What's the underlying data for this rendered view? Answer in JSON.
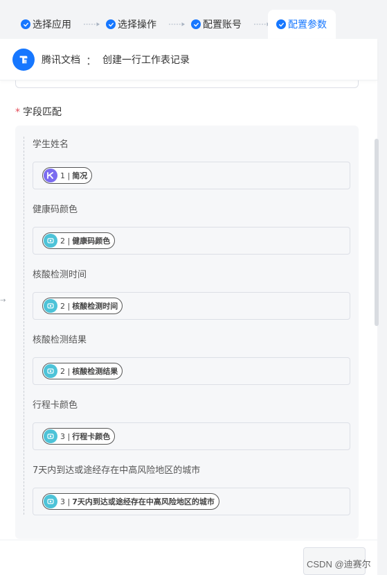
{
  "steps": [
    {
      "label": "选择应用",
      "done": true
    },
    {
      "label": "选择操作",
      "done": true
    },
    {
      "label": "配置账号",
      "done": true
    },
    {
      "label": "配置参数",
      "done": true,
      "active": true
    }
  ],
  "header": {
    "app_name": "腾讯文档",
    "separator": "：",
    "action": "创建一行工作表记录"
  },
  "section": {
    "required_mark": "*",
    "label": "字段匹配"
  },
  "fields": [
    {
      "label": "学生姓名",
      "tag_icon": "kuaiying-icon",
      "tag_num": "1 |",
      "tag_text": "简况"
    },
    {
      "label": "健康码颜色",
      "tag_icon": "module-icon",
      "tag_num": "2 |",
      "tag_text": "健康码颜色"
    },
    {
      "label": "核酸检测时间",
      "tag_icon": "module-icon",
      "tag_num": "2 |",
      "tag_text": "核酸检测时间"
    },
    {
      "label": "核酸检测结果",
      "tag_icon": "module-icon",
      "tag_num": "2 |",
      "tag_text": "核酸检测结果"
    },
    {
      "label": "行程卡颜色",
      "tag_icon": "module-icon",
      "tag_num": "3 |",
      "tag_text": "行程卡颜色"
    },
    {
      "label": "7天内到达或途经存在中高风险地区的城市",
      "tag_icon": "module-icon",
      "tag_num": "3 |",
      "tag_text": "7天内到达或途经存在中高风险地区的城市"
    }
  ],
  "watermark": "CSDN @迪赛尔",
  "colors": {
    "accent": "#1677ff",
    "purple": "#7b6cf0",
    "teal": "#4dc3d8",
    "required": "#e34d59"
  }
}
